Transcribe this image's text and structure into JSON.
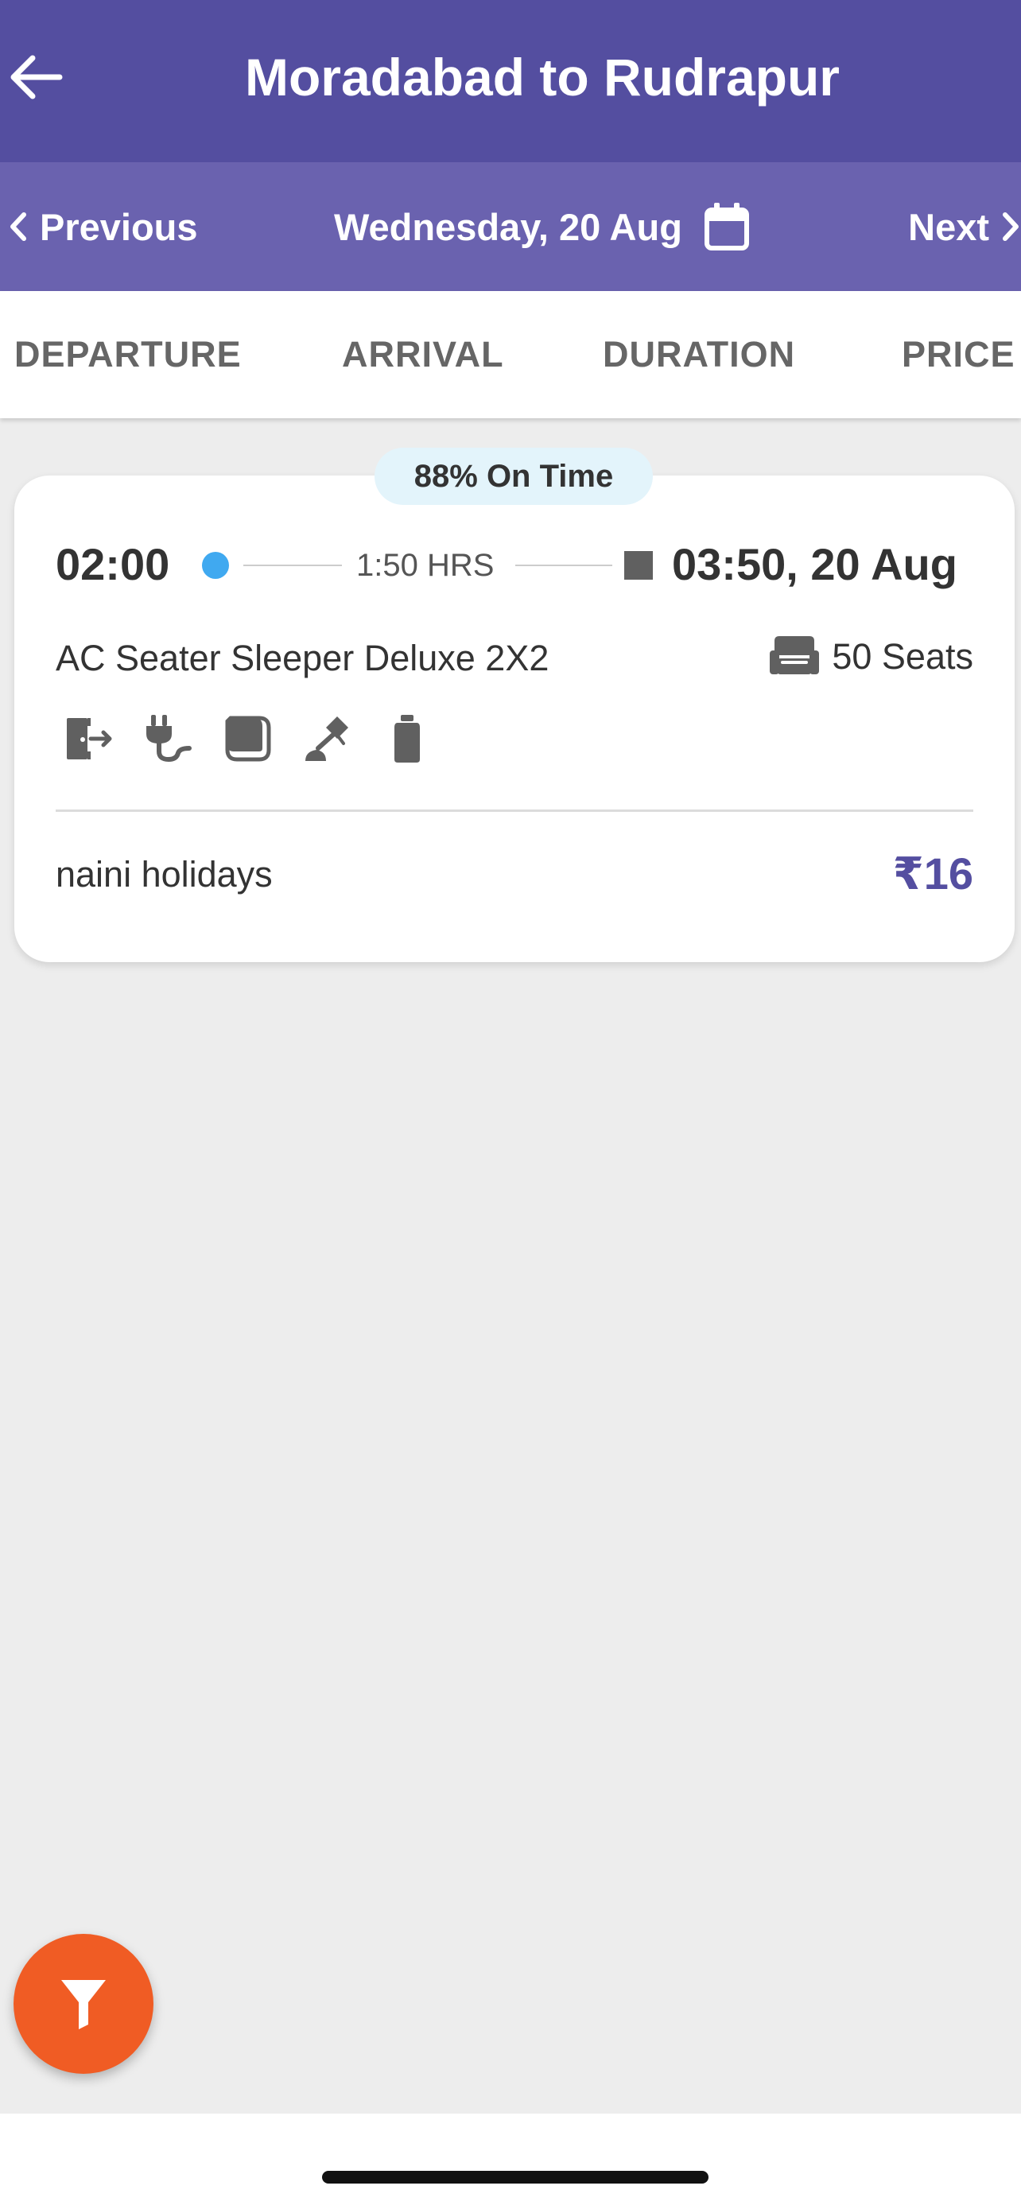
{
  "header": {
    "title": "Moradabad to Rudrapur",
    "back_icon": "arrow-left-icon",
    "background_color": "#544ea0"
  },
  "date_bar": {
    "previous_label": "Previous",
    "next_label": "Next",
    "date_label": "Wednesday, 20 Aug",
    "calendar_icon": "calendar-icon",
    "background_color": "#6a62af"
  },
  "sort_tabs": [
    {
      "label": "DEPARTURE"
    },
    {
      "label": "ARRIVAL"
    },
    {
      "label": "DURATION"
    },
    {
      "label": "PRICE"
    }
  ],
  "results": [
    {
      "on_time": "88% On Time",
      "departure_time": "02:00",
      "duration": "1:50 HRS",
      "arrival": "03:50, 20 Aug",
      "bus_type": "AC Seater Sleeper Deluxe 2X2",
      "seats": "50 Seats",
      "amenities": [
        "emergency-exit-icon",
        "charging-point-icon",
        "blanket-icon",
        "reading-light-icon",
        "water-bottle-icon"
      ],
      "operator": "naini holidays",
      "price": "₹16",
      "price_color": "#544ea0"
    }
  ],
  "filter_button": {
    "icon": "filter-icon",
    "color": "#f05c24"
  }
}
